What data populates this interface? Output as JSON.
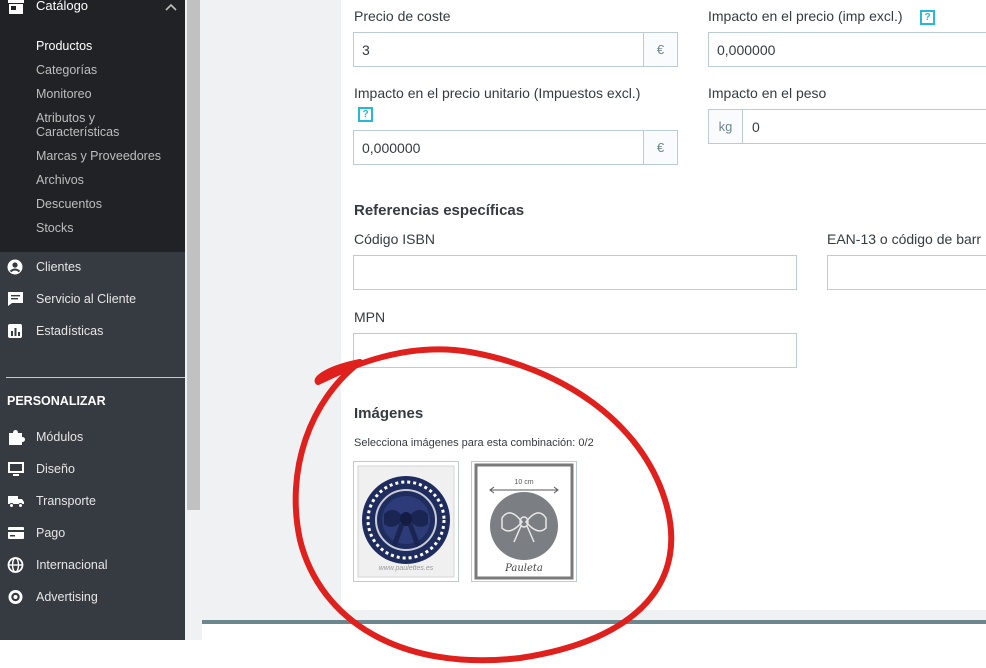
{
  "sidebar": {
    "catalog": {
      "label": "Catálogo",
      "icon": "store-icon"
    },
    "catalog_items": [
      {
        "label": "Productos",
        "active": true
      },
      {
        "label": "Categorías"
      },
      {
        "label": "Monitoreo"
      },
      {
        "label": "Atributos y Características"
      },
      {
        "label": "Marcas y Proveedores"
      },
      {
        "label": "Archivos"
      },
      {
        "label": "Descuentos"
      },
      {
        "label": "Stocks"
      }
    ],
    "items": [
      {
        "label": "Clientes",
        "icon": "user-icon"
      },
      {
        "label": "Servicio al Cliente",
        "icon": "chat-icon"
      },
      {
        "label": "Estadísticas",
        "icon": "stats-icon"
      }
    ],
    "section_title": "PERSONALIZAR",
    "personalize_items": [
      {
        "label": "Módulos",
        "icon": "puzzle-icon"
      },
      {
        "label": "Diseño",
        "icon": "monitor-icon"
      },
      {
        "label": "Transporte",
        "icon": "truck-icon"
      },
      {
        "label": "Pago",
        "icon": "card-icon"
      },
      {
        "label": "Internacional",
        "icon": "globe-icon"
      },
      {
        "label": "Advertising",
        "icon": "advertising-icon"
      }
    ]
  },
  "form": {
    "cost_price": {
      "label": "Precio de coste",
      "value": "3",
      "addon": "€"
    },
    "price_impact": {
      "label": "Impacto en el precio (imp excl.)",
      "value": "0,000000",
      "help": "?"
    },
    "unit_price_impact": {
      "label": "Impacto en el precio unitario (Impuestos excl.)",
      "value": "0,000000",
      "addon": "€",
      "help": "?"
    },
    "weight_impact": {
      "label": "Impacto en el peso",
      "value": "0",
      "addon": "kg"
    },
    "specific_refs": {
      "heading": "Referencias específicas",
      "isbn_label": "Código ISBN",
      "ean_label": "EAN-13 o código de barr",
      "mpn_label": "MPN"
    },
    "images": {
      "heading": "Imágenes",
      "caption": "Selecciona imágenes para esta combinación: 0/2",
      "thumb1_watermark": "www.paulettes.es",
      "thumb2_dimension": "10 cm",
      "thumb2_brand": "Pauleta"
    }
  },
  "colors": {
    "sidebar_bg": "#363a41",
    "sidebar_active_bg": "#202226",
    "help_accent": "#25b9d7",
    "annotation_red": "#e0201c"
  }
}
